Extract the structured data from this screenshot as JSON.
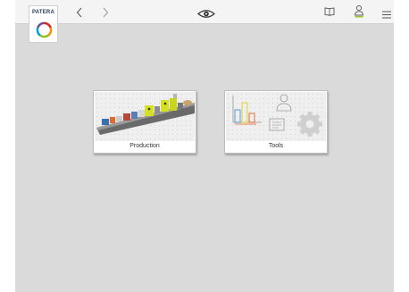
{
  "topbar": {
    "logo_text": "PATERA",
    "back_icon": "chevron-left-icon",
    "forward_icon": "chevron-right-icon",
    "view_icon": "eye-icon",
    "book_icon": "book-icon",
    "user_icon": "user-icon",
    "menu_icon": "hamburger-menu-icon"
  },
  "tiles": [
    {
      "label": "Production",
      "image": "production-line-illustration"
    },
    {
      "label": "Tools",
      "image": "tools-illustration"
    }
  ],
  "colors": {
    "app_background": "#dadada",
    "topbar_background": "#f4f4f4",
    "accent_green": "#8fc31f",
    "logo_text": "#2a3a55"
  }
}
